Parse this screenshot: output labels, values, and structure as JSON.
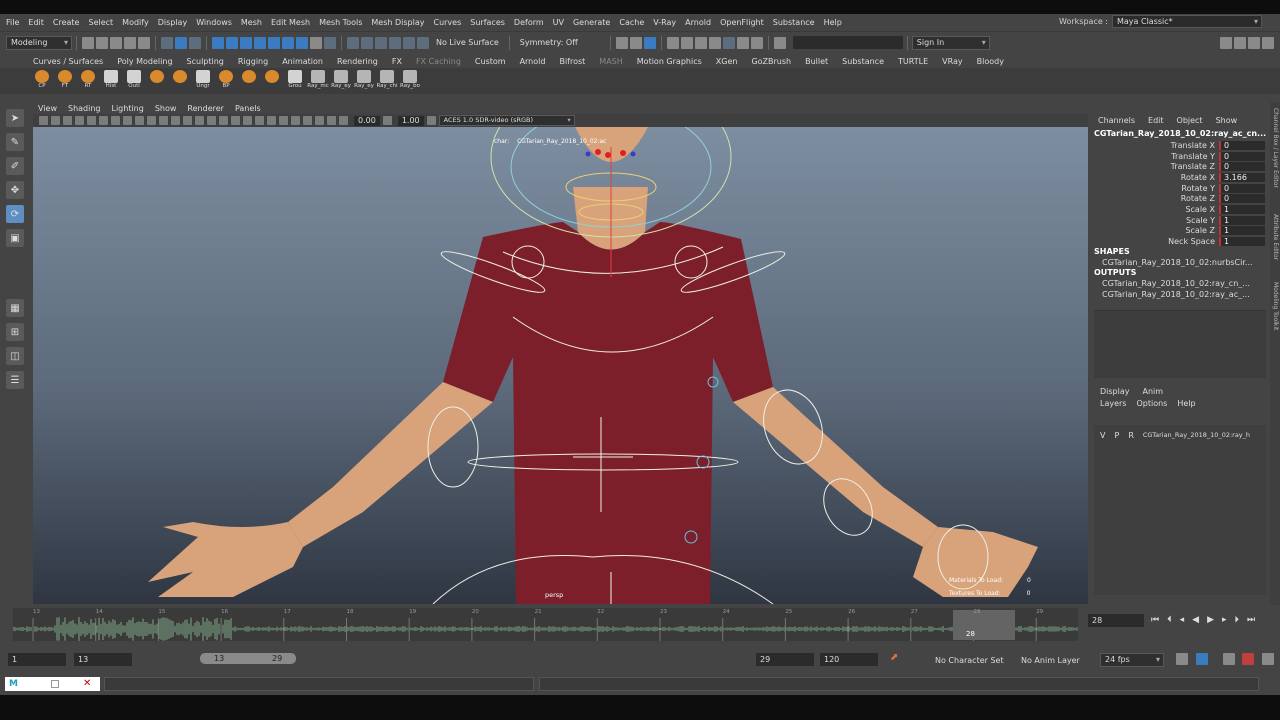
{
  "menubar": {
    "items": [
      "File",
      "Edit",
      "Create",
      "Select",
      "Modify",
      "Display",
      "Windows",
      "Mesh",
      "Edit Mesh",
      "Mesh Tools",
      "Mesh Display",
      "Curves",
      "Surfaces",
      "Deform",
      "UV",
      "Generate",
      "Cache",
      "V-Ray",
      "Arnold",
      "OpenFlight",
      "Substance",
      "Help"
    ],
    "workspace_label": "Workspace :",
    "workspace_value": "Maya Classic*"
  },
  "statusline": {
    "mode": "Modeling",
    "live_surface": "No Live Surface",
    "symmetry": "Symmetry: Off",
    "sign_in": "Sign In"
  },
  "shelf": {
    "tabs": [
      "Curves / Surfaces",
      "Poly Modeling",
      "Sculpting",
      "Rigging",
      "Animation",
      "Rendering",
      "FX",
      "FX Caching",
      "Custom",
      "Arnold",
      "Bifrost",
      "MASH",
      "Motion Graphics",
      "XGen",
      "GoZBrush",
      "Bullet",
      "Substance",
      "TURTLE",
      "VRay",
      "Bloody"
    ],
    "active_tab": "Curves / Surfaces",
    "icons": [
      {
        "label": "CP"
      },
      {
        "label": "FT"
      },
      {
        "label": "RT"
      },
      {
        "label": "Hist"
      },
      {
        "label": "Outl"
      },
      {
        "label": ""
      },
      {
        "label": ""
      },
      {
        "label": "Ungr"
      },
      {
        "label": "BP"
      },
      {
        "label": ""
      },
      {
        "label": ""
      },
      {
        "label": "Grou"
      },
      {
        "label": "Ray_mc"
      },
      {
        "label": "Ray_ey"
      },
      {
        "label": "Ray_ey"
      },
      {
        "label": "Ray_chi"
      },
      {
        "label": "Ray_bo"
      }
    ]
  },
  "viewport": {
    "menus": [
      "View",
      "Shading",
      "Lighting",
      "Show",
      "Renderer",
      "Panels"
    ],
    "field1": "0.00",
    "field2": "1.00",
    "colorspace": "ACES 1.0 SDR-video (sRGB)",
    "camera_hud_label": "char:",
    "camera_hud_value": "CGTarian_Ray_2018_10_02:ac",
    "camera_name": "persp",
    "materials_to_load_label": "Materials To Load:",
    "materials_to_load_value": "0",
    "textures_to_load_label": "Textures To Load:",
    "textures_to_load_value": "0"
  },
  "channelbox": {
    "menus": [
      "Channels",
      "Edit",
      "Object",
      "Show"
    ],
    "node_name": "CGTarian_Ray_2018_10_02:ray_ac_cn...",
    "attributes": [
      {
        "name": "Translate X",
        "value": "0"
      },
      {
        "name": "Translate Y",
        "value": "0"
      },
      {
        "name": "Translate Z",
        "value": "0"
      },
      {
        "name": "Rotate X",
        "value": "3.166"
      },
      {
        "name": "Rotate Y",
        "value": "0"
      },
      {
        "name": "Rotate Z",
        "value": "0"
      },
      {
        "name": "Scale X",
        "value": "1"
      },
      {
        "name": "Scale Y",
        "value": "1"
      },
      {
        "name": "Scale Z",
        "value": "1"
      },
      {
        "name": "Neck Space",
        "value": "1"
      }
    ],
    "shapes_label": "SHAPES",
    "shapes": [
      "CGTarian_Ray_2018_10_02:nurbsCir..."
    ],
    "outputs_label": "OUTPUTS",
    "outputs": [
      "CGTarian_Ray_2018_10_02:ray_cn_...",
      "CGTarian_Ray_2018_10_02:ray_ac_..."
    ]
  },
  "layers": {
    "tabs": [
      "Display",
      "Anim"
    ],
    "menus": [
      "Layers",
      "Options",
      "Help"
    ],
    "row": {
      "v": "V",
      "p": "P",
      "r": "R",
      "name": "CGTarian_Ray_2018_10_02:ray_h"
    }
  },
  "sidetabs": [
    "Channel Box / Layer Editor",
    "Attribute Editor",
    "Modeling Toolkit"
  ],
  "timeline": {
    "ticks": [
      "13",
      "14",
      "15",
      "16",
      "17",
      "18",
      "19",
      "20",
      "21",
      "22",
      "23",
      "24",
      "25",
      "26",
      "27",
      "28",
      "29"
    ],
    "current_frame": "28",
    "frame_field": "28"
  },
  "range": {
    "start": "1",
    "anim_start": "13",
    "slider_start": "13",
    "slider_end": "29",
    "anim_end": "29",
    "end": "120",
    "character_set": "No Character Set",
    "anim_layer": "No Anim Layer",
    "fps": "24 fps"
  },
  "colors": {
    "accent": "#5e8ec2",
    "shirt": "#7c1f2b",
    "skin": "#d8a27b",
    "rig_controls": "#f0f0e6",
    "timeline_audio": "#7fa884"
  }
}
